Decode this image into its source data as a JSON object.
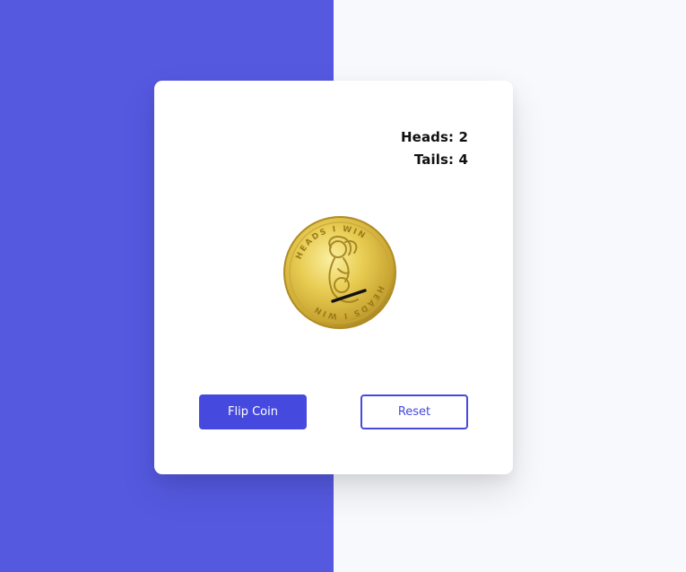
{
  "colors": {
    "left_background": "#5559e0",
    "right_background": "#f8f9fc",
    "accent": "#4649de",
    "coin_gold": "#e8cc52",
    "coin_dark": "#b8962a"
  },
  "score": {
    "heads_label": "Heads: 2",
    "tails_label": "Tails: 4"
  },
  "coin": {
    "icon": "coin-heads-icon",
    "ring_text": "HEADS I WIN"
  },
  "buttons": {
    "flip_label": "Flip Coin",
    "reset_label": "Reset"
  }
}
